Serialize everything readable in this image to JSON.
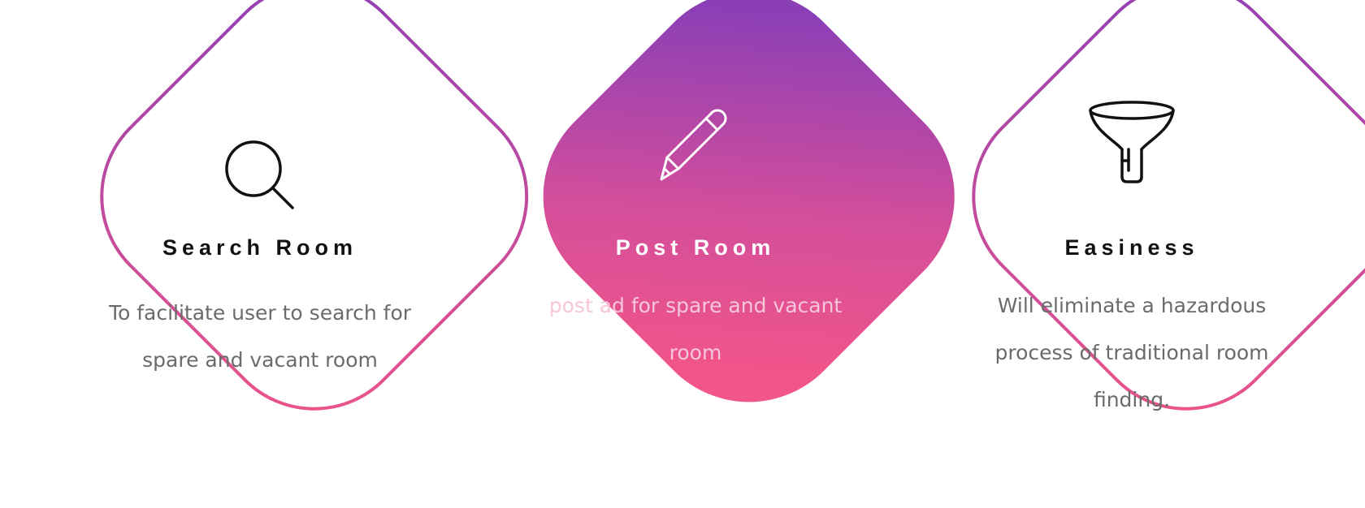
{
  "colors": {
    "gradient_start": "#8a3fb6",
    "gradient_end": "#f25588",
    "title_dark": "#111111",
    "desc_gray": "#6b6b6b",
    "title_light": "#ffffff",
    "desc_light": "#f6c6d9"
  },
  "features": [
    {
      "icon": "search-icon",
      "title": "Search Room",
      "description": "To facilitate user to search for spare and vacant room"
    },
    {
      "icon": "pencil-icon",
      "title": "Post Room",
      "description": "post ad for spare and vacant room"
    },
    {
      "icon": "funnel-icon",
      "title": "Easiness",
      "description": "Will eliminate a hazardous process of traditional room finding."
    }
  ]
}
